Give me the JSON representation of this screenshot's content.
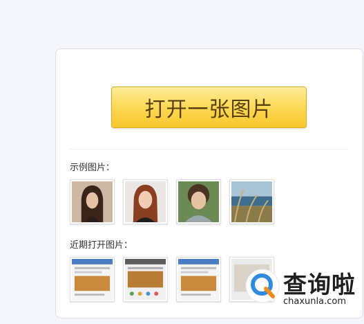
{
  "open_button": {
    "label": "打开一张图片"
  },
  "sample_section": {
    "label": "示例图片：",
    "images": [
      {
        "subject": "woman-dark-hair"
      },
      {
        "subject": "woman-red-hair"
      },
      {
        "subject": "child-curly-hair"
      },
      {
        "subject": "grass-seaside"
      }
    ]
  },
  "recent_section": {
    "label": "近期打开图片：",
    "images": [
      {
        "subject": "app-screenshot-1"
      },
      {
        "subject": "app-screenshot-2"
      },
      {
        "subject": "app-screenshot-3"
      },
      {
        "subject": "app-screenshot-4"
      }
    ]
  },
  "watermark": {
    "logo_icon": "magnifier-q-logo-icon",
    "brand": "查询啦",
    "url": "chaxunla.com"
  },
  "colors": {
    "button_top": "#ffec9c",
    "button_bottom": "#f8c62b",
    "button_text": "#5b3f08",
    "watermark_blue": "#2f8be0",
    "watermark_orange": "#f28c1b"
  }
}
